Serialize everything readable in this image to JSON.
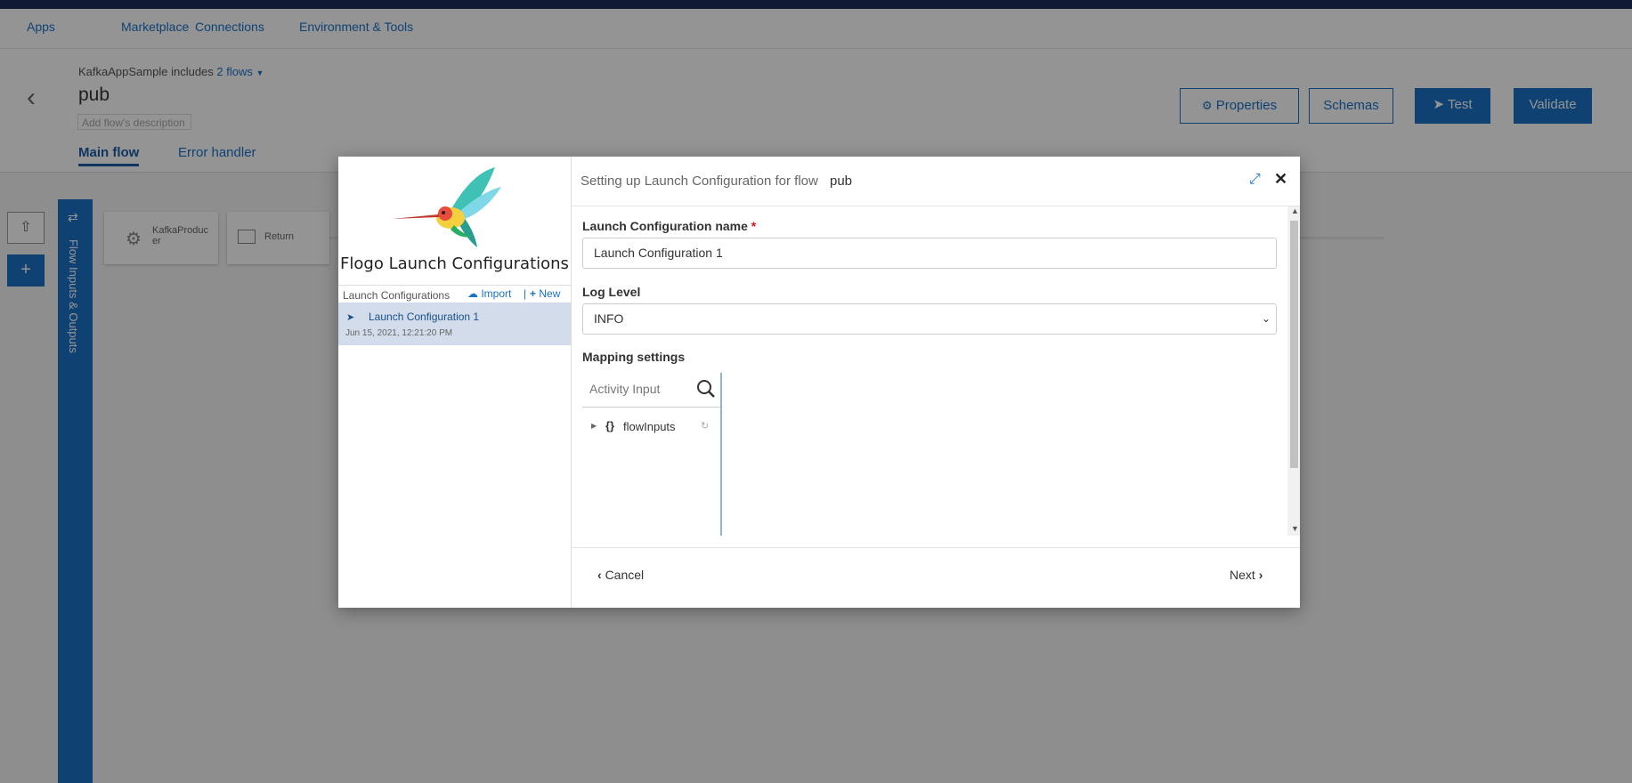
{
  "nav": {
    "items": [
      "Apps",
      "Marketplace",
      "Connections",
      "Environment & Tools"
    ]
  },
  "header": {
    "app_name": "KafkaAppSample",
    "includes_text": "includes",
    "flows_link": "2 flows",
    "flow_name": "pub",
    "description_placeholder": "Add flow's description",
    "tabs": [
      "Main flow",
      "Error handler"
    ],
    "buttons": {
      "properties": "Properties",
      "schemas": "Schemas",
      "test": "Test",
      "validate": "Validate"
    }
  },
  "flow_bar": {
    "label": "Flow Inputs & Outputs"
  },
  "canvas": {
    "tiles": [
      "KafkaProducer",
      "Return"
    ]
  },
  "modal": {
    "logo_title": "Flogo Launch Configurations",
    "list_header": "Launch Configurations",
    "import_label": "Import",
    "new_label": "New",
    "list_item": {
      "name": "Launch Configuration 1",
      "date": "Jun 15, 2021, 12:21:20 PM"
    },
    "title_prefix": "Setting up Launch Configuration for flow",
    "title_flow": "pub",
    "fields": {
      "name_label": "Launch Configuration name",
      "name_required": "*",
      "name_value": "Launch Configuration 1",
      "log_level_label": "Log Level",
      "log_level_value": "INFO",
      "mapping_label": "Mapping settings",
      "activity_input_placeholder": "Activity Input",
      "tree_root": "flowInputs"
    },
    "footer": {
      "cancel": "Cancel",
      "next": "Next"
    }
  },
  "colors": {
    "accent": "#1a73c7",
    "top_strip": "#1d2e5a",
    "overlay": "rgba(0,0,0,0.42)",
    "selected_row": "#d3dcea"
  }
}
